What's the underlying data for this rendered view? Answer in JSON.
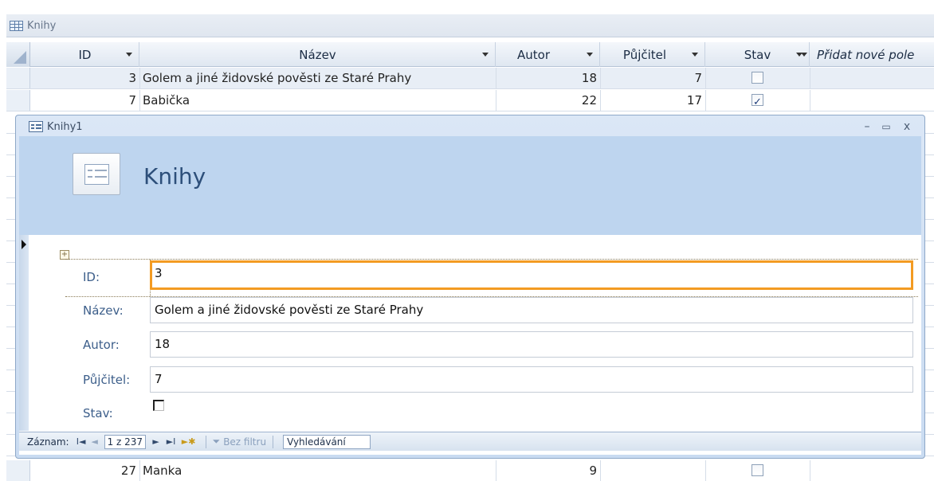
{
  "table_tab": {
    "title": "Knihy"
  },
  "columns": [
    {
      "label": "ID"
    },
    {
      "label": "Název"
    },
    {
      "label": "Autor"
    },
    {
      "label": "Půjčitel"
    },
    {
      "label": "Stav"
    },
    {
      "label": "Přidat nové pole"
    }
  ],
  "rows": [
    {
      "id": "3",
      "nazev": "Golem a jiné židovské pověsti ze Staré Prahy",
      "autor": "18",
      "pujcitel": "7",
      "stav": false
    },
    {
      "id": "7",
      "nazev": "Babička",
      "autor": "22",
      "pujcitel": "17",
      "stav": true
    },
    {
      "id": "27",
      "nazev": "Manka",
      "autor": "9",
      "pujcitel": "",
      "stav": false
    }
  ],
  "form_window": {
    "title": "Knihy1",
    "minimize": "–",
    "maximize": "▭",
    "close": "x",
    "heading": "Knihy",
    "fields": {
      "id": {
        "label": "ID:",
        "value": "3"
      },
      "nazev": {
        "label": "Název:",
        "value": "Golem a jiné židovské pověsti ze Staré Prahy"
      },
      "autor": {
        "label": "Autor:",
        "value": "18"
      },
      "pujcitel": {
        "label": "Půjčitel:",
        "value": "7"
      },
      "stav": {
        "label": "Stav:",
        "checked": false
      }
    }
  },
  "nav": {
    "label": "Záznam:",
    "first": "I◄",
    "prev": "◄",
    "current": "1 z 237",
    "next": "►",
    "last": "►I",
    "new": "►✱",
    "filter_label": "Bez filtru",
    "search": "Vyhledávání"
  }
}
